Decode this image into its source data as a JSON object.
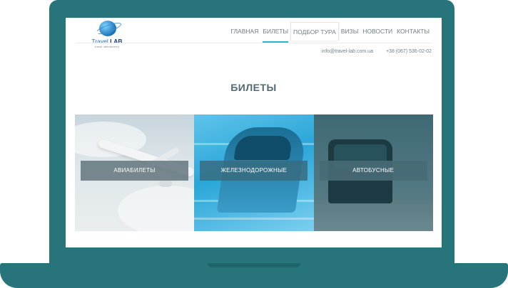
{
  "logo": {
    "brand_a": "Travel",
    "brand_b": "LAB",
    "tagline": "travel laboratories"
  },
  "nav": [
    {
      "label": "ГЛАВНАЯ"
    },
    {
      "label": "БИЛЕТЫ"
    },
    {
      "label": "ПОДБОР ТУРА"
    },
    {
      "label": "ВИЗЫ"
    },
    {
      "label": "НОВОСТИ"
    },
    {
      "label": "КОНТАКТЫ"
    }
  ],
  "contacts": {
    "email": "info@travel-lab.com.ua",
    "phone": "+38 (067) 536-02-02"
  },
  "page": {
    "title": "БИЛЕТЫ"
  },
  "tiles": [
    {
      "label": "АВИАБИЛЕТЫ"
    },
    {
      "label": "ЖЕЛЕЗНОДОРОЖНЫЕ"
    },
    {
      "label": "АВТОБУСНЫЕ"
    }
  ],
  "colors": {
    "frame": "#27757a",
    "accent": "#2fb4c9",
    "text": "#6f7f86"
  }
}
